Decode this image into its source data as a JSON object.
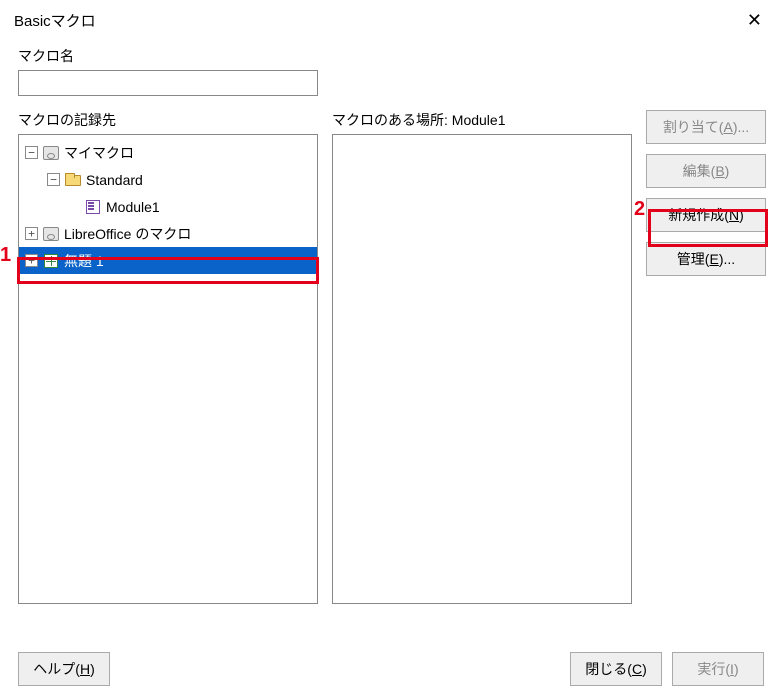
{
  "title": "Basicマクロ",
  "labels": {
    "macro_name": "マクロ名",
    "macro_save_to": "マクロの記録先",
    "macro_location_prefix": "マクロのある場所: ",
    "macro_location_module": "Module1"
  },
  "macro_name_value": "",
  "tree": {
    "my_macros": "マイマクロ",
    "standard": "Standard",
    "module1": "Module1",
    "libreoffice_macros": "LibreOffice のマクロ",
    "untitled1": "無題 1"
  },
  "buttons": {
    "assign": {
      "pre": "割り当て(",
      "key": "A",
      "post": ")..."
    },
    "edit": {
      "pre": "編集(",
      "key": "B",
      "post": ")"
    },
    "new": {
      "pre": "新規作成(",
      "key": "N",
      "post": ")"
    },
    "manage": {
      "pre": "管理(",
      "key": "E",
      "post": ")..."
    },
    "help": {
      "pre": "ヘルプ(",
      "key": "H",
      "post": ")"
    },
    "close": {
      "pre": "閉じる(",
      "key": "C",
      "post": ")"
    },
    "run": {
      "pre": "実行(",
      "key": "I",
      "post": ")"
    }
  },
  "callouts": {
    "one": "1",
    "two": "2"
  }
}
